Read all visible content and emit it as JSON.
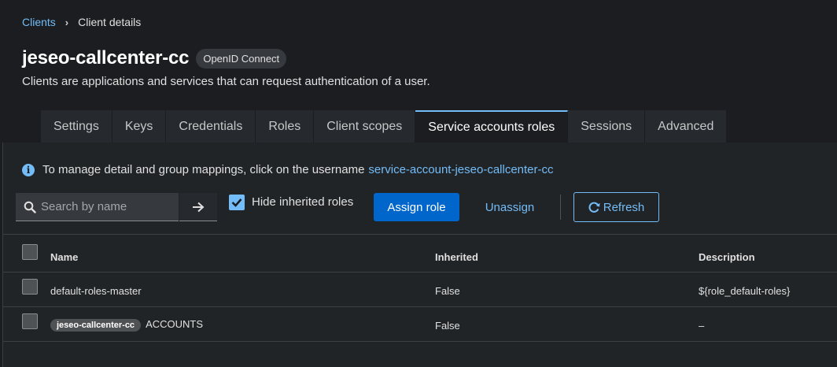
{
  "breadcrumb": {
    "parent": "Clients",
    "current": "Client details"
  },
  "header": {
    "title": "jeseo-callcenter-cc",
    "protocol_badge": "OpenID Connect",
    "subtitle": "Clients are applications and services that can request authentication of a user."
  },
  "tabs": [
    {
      "label": "Settings",
      "active": false
    },
    {
      "label": "Keys",
      "active": false
    },
    {
      "label": "Credentials",
      "active": false
    },
    {
      "label": "Roles",
      "active": false
    },
    {
      "label": "Client scopes",
      "active": false
    },
    {
      "label": "Service accounts roles",
      "active": true
    },
    {
      "label": "Sessions",
      "active": false
    },
    {
      "label": "Advanced",
      "active": false
    }
  ],
  "info": {
    "text": "To manage detail and group mappings, click on the username",
    "link": "service-account-jeseo-callcenter-cc"
  },
  "toolbar": {
    "search_placeholder": "Search by name",
    "hide_inherited_label": "Hide inherited roles",
    "hide_inherited_checked": true,
    "assign_label": "Assign role",
    "unassign_label": "Unassign",
    "refresh_label": "Refresh"
  },
  "table": {
    "columns": [
      "Name",
      "Inherited",
      "Description"
    ],
    "rows": [
      {
        "name": "default-roles-master",
        "chip": "",
        "inherited": "False",
        "description": "${role_default-roles}"
      },
      {
        "name": "ACCOUNTS",
        "chip": "jeseo-callcenter-cc",
        "inherited": "False",
        "description": "–"
      }
    ]
  },
  "colors": {
    "accent": "#73bcf7",
    "primary_button": "#0066cc",
    "background": "#1b1d21",
    "panel": "#212427"
  }
}
